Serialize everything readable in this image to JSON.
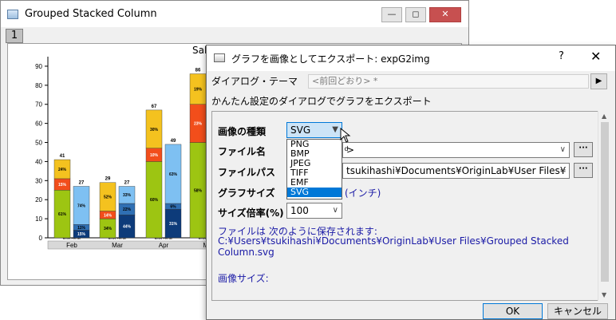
{
  "graph_window": {
    "title": "Grouped Stacked Column",
    "layer_tab": "1",
    "graph_title_fragment": "Sal",
    "min_glyph": "—",
    "max_glyph": "◻",
    "close_glyph": "✕"
  },
  "chart_data": {
    "type": "bar",
    "subtype": "grouped-stacked",
    "categories": [
      "Feb",
      "Mar",
      "Apr",
      "Ma"
    ],
    "category_sublabels": "BMW Ferrari",
    "ylim": [
      0,
      95
    ],
    "yticks": [
      0,
      10,
      20,
      30,
      40,
      50,
      60,
      70,
      80,
      90
    ],
    "groups": [
      {
        "category": "Feb",
        "stack": "BMW",
        "total": 41,
        "segments": [
          {
            "color": "#9dc512",
            "value": 25,
            "label": "61%"
          },
          {
            "color": "#f24e1b",
            "value": 6,
            "label": "15%"
          },
          {
            "color": "#f4c21f",
            "value": 10,
            "label": "24%"
          }
        ]
      },
      {
        "category": "Feb",
        "stack": "Ferrari",
        "total": 27,
        "segments": [
          {
            "color": "#0d3b7a",
            "value": 4,
            "label": "15%"
          },
          {
            "color": "#2f6fb3",
            "value": 3,
            "label": "11%"
          },
          {
            "color": "#7ec0f2",
            "value": 20,
            "label": "74%"
          }
        ]
      },
      {
        "category": "Mar",
        "stack": "BMW",
        "total": 29,
        "segments": [
          {
            "color": "#9dc512",
            "value": 10,
            "label": "34%"
          },
          {
            "color": "#f24e1b",
            "value": 4,
            "label": "14%"
          },
          {
            "color": "#f4c21f",
            "value": 15,
            "label": "52%"
          }
        ]
      },
      {
        "category": "Mar",
        "stack": "Ferrari",
        "total": 27,
        "segments": [
          {
            "color": "#0d3b7a",
            "value": 12,
            "label": "44%"
          },
          {
            "color": "#2f6fb3",
            "value": 6,
            "label": "22%"
          },
          {
            "color": "#7ec0f2",
            "value": 9,
            "label": "33%"
          }
        ]
      },
      {
        "category": "Apr",
        "stack": "BMW",
        "total": 67,
        "segments": [
          {
            "color": "#9dc512",
            "value": 40,
            "label": "60%"
          },
          {
            "color": "#f24e1b",
            "value": 7,
            "label": "10%"
          },
          {
            "color": "#f4c21f",
            "value": 20,
            "label": "30%"
          }
        ]
      },
      {
        "category": "Apr",
        "stack": "Ferrari",
        "total": 49,
        "segments": [
          {
            "color": "#0d3b7a",
            "value": 15,
            "label": "31%"
          },
          {
            "color": "#2f6fb3",
            "value": 3,
            "label": "6%"
          },
          {
            "color": "#7ec0f2",
            "value": 31,
            "label": "63%"
          }
        ]
      },
      {
        "category": "Ma",
        "stack": "BMW",
        "total": 86,
        "segments": [
          {
            "color": "#9dc512",
            "value": 50,
            "label": "58%"
          },
          {
            "color": "#f24e1b",
            "value": 20,
            "label": "23%"
          },
          {
            "color": "#f4c21f",
            "value": 16,
            "label": "19%"
          }
        ]
      }
    ]
  },
  "dialog": {
    "title": "グラフを画像としてエクスポート: expG2img",
    "help_glyph": "?",
    "close_glyph": "✕",
    "theme_label": "ダイアログ・テーマ",
    "theme_value": "<前回どおり> *",
    "theme_button_glyph": "▶",
    "subtitle": "かんたん設定のダイアログでグラフをエクスポート",
    "image_type_label": "画像の種類",
    "image_type_value": "SVG",
    "image_type_options": [
      "PNG",
      "BMP",
      "JPEG",
      "TIFF",
      "EMF",
      "SVG"
    ],
    "file_name_label": "ファイル名",
    "file_name_value": "ͩ>",
    "file_path_label": "ファイルパス",
    "file_path_value": "tsukihashi¥Documents¥OriginLab¥User Files¥",
    "graph_size_label": "グラフサイズ",
    "graph_size_value": "(インチ)",
    "scale_label": "サイズ倍率(%)",
    "scale_value": "100",
    "saved_as_line1": "ファイルは 次のように保存されます:",
    "saved_as_line2": "C:¥Users¥tsukihashi¥Documents¥OriginLab¥User Files¥Grouped Stacked",
    "saved_as_line3": "Column.svg",
    "image_size_label": "画像サイズ:",
    "more_glyph": "···",
    "ok_label": "OK",
    "cancel_label": "キャンセル"
  }
}
